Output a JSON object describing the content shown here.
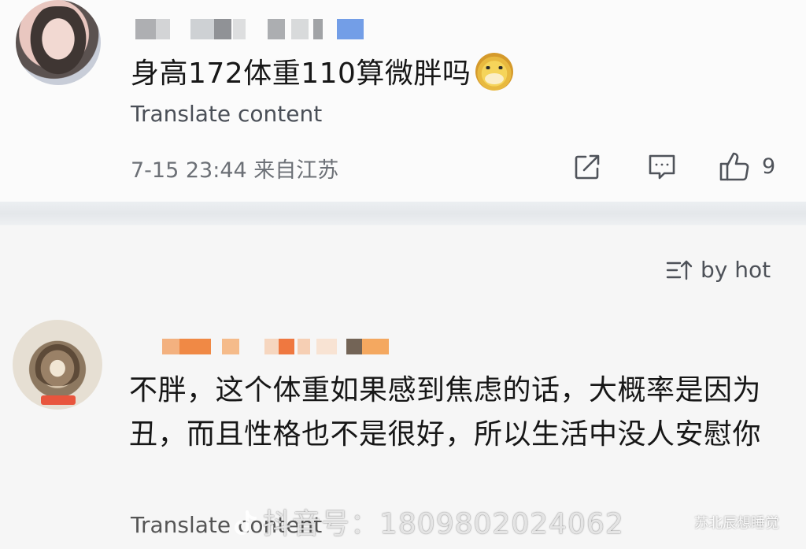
{
  "post": {
    "comment_text": "身高172体重110算微胖吗",
    "emoji_icon": "doge-emoji-icon",
    "translate_label": "Translate content",
    "timestamp": "7-15 23:44",
    "location": "来自江苏",
    "like_count": "9",
    "icons": [
      "share-icon",
      "comment-icon",
      "like-icon"
    ]
  },
  "sort": {
    "label": "by hot",
    "icon": "sort-icon"
  },
  "reply": {
    "comment_text": "不胖，这个体重如果感到焦虑的话，大概率是因为丑，而且性格也不是很好，所以生活中没人安慰你",
    "translate_label": "Translate content"
  },
  "watermark": {
    "text": "抖音号：1809802024062",
    "corner_text": "苏北辰想睡觉"
  },
  "colors": {
    "accent_blue": "#5a8de3",
    "username_blur_orange": "#f08a3c",
    "text_primary": "#171717",
    "text_secondary": "#6c7076"
  }
}
